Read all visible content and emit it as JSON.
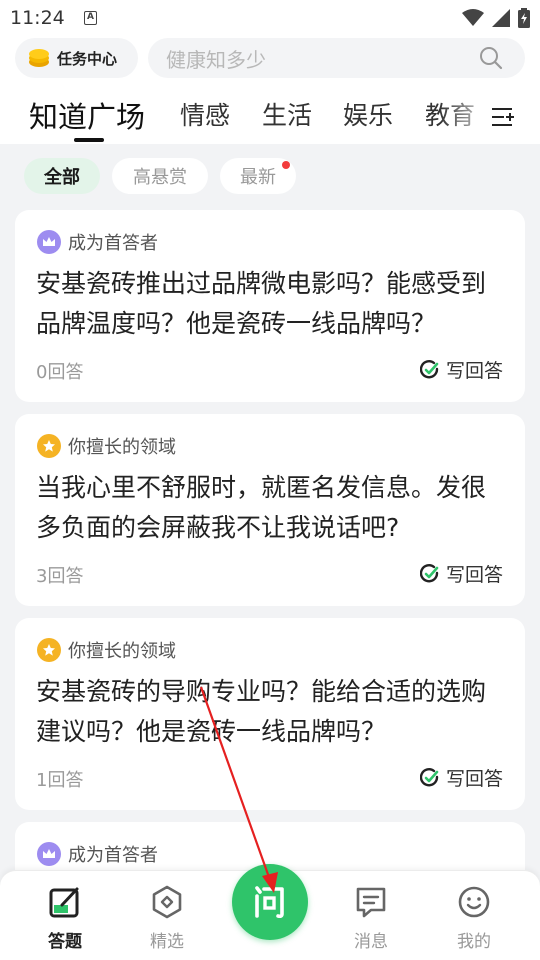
{
  "status_bar": {
    "time": "11:24",
    "notification": "A"
  },
  "header": {
    "task_center_label": "任务中心",
    "search_placeholder": "健康知多少"
  },
  "tabs": [
    {
      "label": "知道广场",
      "active": true
    },
    {
      "label": "情感",
      "active": false
    },
    {
      "label": "生活",
      "active": false
    },
    {
      "label": "娱乐",
      "active": false
    },
    {
      "label": "教育",
      "active": false
    }
  ],
  "filters": [
    {
      "label": "全部",
      "active": true
    },
    {
      "label": "高悬赏",
      "active": false
    },
    {
      "label": "最新",
      "active": false,
      "badge": true
    }
  ],
  "cards": [
    {
      "tag": "成为首答者",
      "tag_icon": "crown-icon",
      "question": "安基瓷砖推出过品牌微电影吗？能感受到品牌温度吗？他是瓷砖一线品牌吗？",
      "answers": "0回答",
      "action": "写回答"
    },
    {
      "tag": "你擅长的领域",
      "tag_icon": "star-icon",
      "question": "当我心里不舒服时，就匿名发信息。发很多负面的会屏蔽我不让我说话吧?",
      "answers": "3回答",
      "action": "写回答"
    },
    {
      "tag": "你擅长的领域",
      "tag_icon": "star-icon",
      "question": "安基瓷砖的导购专业吗？能给合适的选购建议吗？他是瓷砖一线品牌吗？",
      "answers": "1回答",
      "action": "写回答"
    },
    {
      "tag": "成为首答者",
      "tag_icon": "crown-icon"
    }
  ],
  "bottom_nav": [
    {
      "label": "答题",
      "icon": "answer-icon",
      "active": true
    },
    {
      "label": "精选",
      "icon": "featured-icon",
      "active": false
    },
    {
      "label": "问",
      "icon": "ask-icon",
      "active": false
    },
    {
      "label": "消息",
      "icon": "message-icon",
      "active": false
    },
    {
      "label": "我的",
      "icon": "profile-icon",
      "active": false
    }
  ],
  "colors": {
    "accent_green": "#2fc46a",
    "active_chip_bg": "#e3f4e9",
    "badge_red": "#f23c3c",
    "annotation_arrow": "#e52020"
  }
}
